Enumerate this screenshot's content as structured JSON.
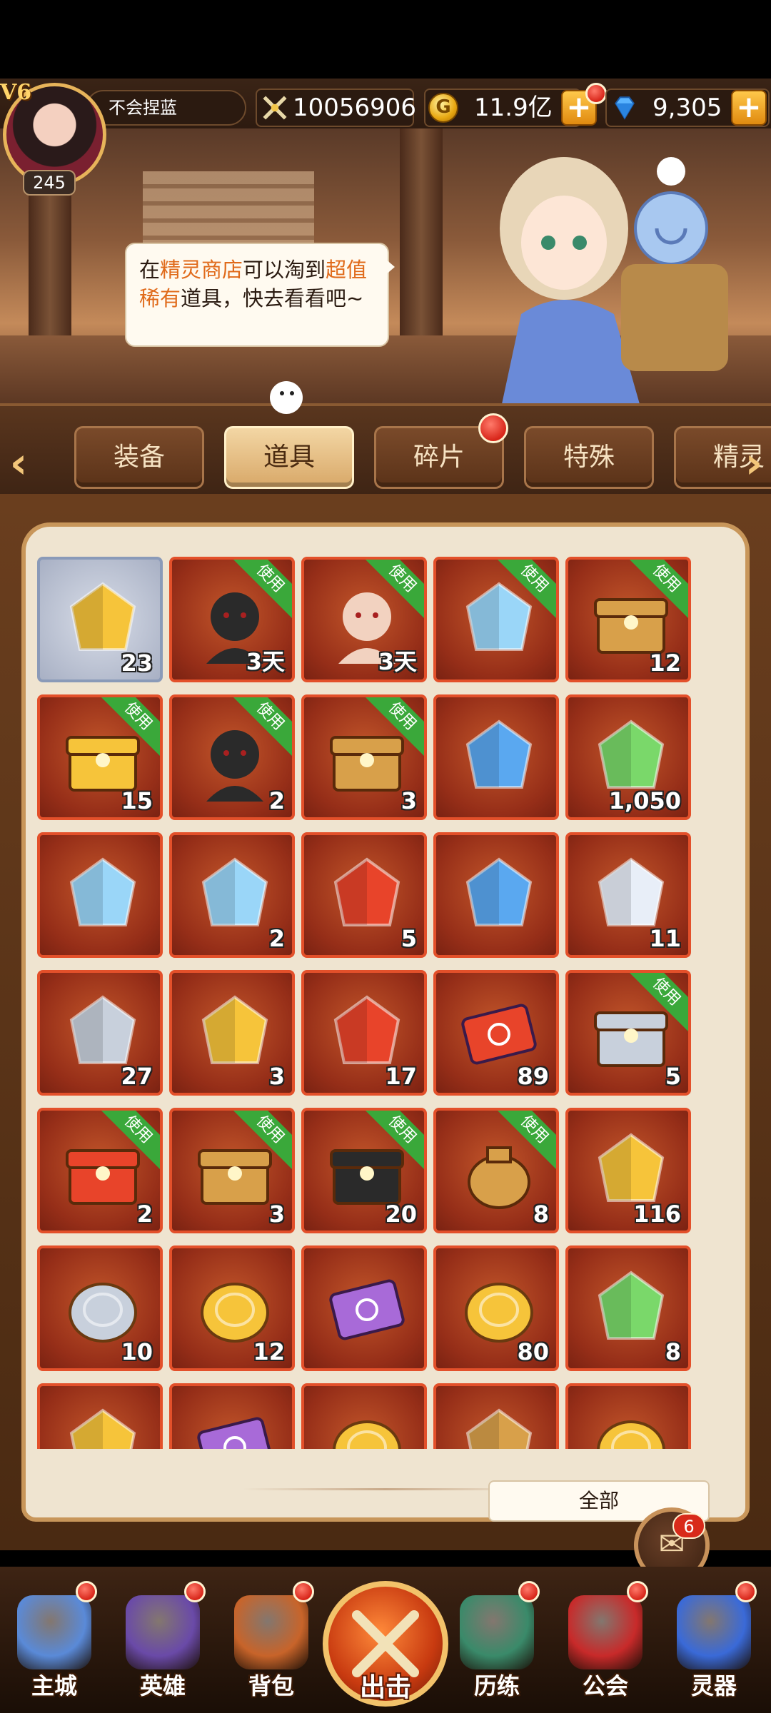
{
  "player": {
    "vip": "V6",
    "level": "245",
    "name": "不会捏蓝"
  },
  "currencies": {
    "power": "10056906",
    "gold": "11.9亿",
    "gold_icon": "G",
    "gems": "9,305",
    "plus": "+"
  },
  "npc_speech": {
    "part1": "在",
    "part2": "精灵商店",
    "part3": "可以淘到",
    "part4": "超值稀有",
    "part5": "道具，快去看看吧~"
  },
  "tabs": [
    {
      "label": "装备"
    },
    {
      "label": "道具"
    },
    {
      "label": "碎片"
    },
    {
      "label": "特殊"
    },
    {
      "label": "精灵"
    }
  ],
  "arrows": {
    "left": "‹",
    "right": "›"
  },
  "use_label": "使用",
  "items": [
    {
      "count": "23",
      "icon": "gold-crystal-icon",
      "use": false,
      "gray": true
    },
    {
      "count": "3天",
      "icon": "hero-portrait-dark-hair-icon",
      "use": true
    },
    {
      "count": "3天",
      "icon": "hero-portrait-blonde-icon",
      "use": true
    },
    {
      "count": "",
      "icon": "mystery-blue-crystal-icon",
      "use": true
    },
    {
      "count": "12",
      "icon": "treasure-chest-icon",
      "use": true
    },
    {
      "count": "15",
      "icon": "golden-chest-icon",
      "use": true
    },
    {
      "count": "2",
      "icon": "dark-knight-icon",
      "use": true
    },
    {
      "count": "3",
      "icon": "gem-chest-icon",
      "use": true
    },
    {
      "count": "",
      "icon": "blue-crystal-icon",
      "use": false
    },
    {
      "count": "1,050",
      "icon": "rainbow-crystal-icon",
      "use": false
    },
    {
      "count": "",
      "icon": "ice-crystal-icon",
      "use": false
    },
    {
      "count": "2",
      "icon": "swirl-crystal-icon",
      "use": false
    },
    {
      "count": "5",
      "icon": "fire-crystal-icon",
      "use": false
    },
    {
      "count": "",
      "icon": "rune-crystal-icon",
      "use": false
    },
    {
      "count": "11",
      "icon": "white-crystal-icon",
      "use": false
    },
    {
      "count": "27",
      "icon": "silver-ore-icon",
      "use": false
    },
    {
      "count": "3",
      "icon": "gold-diamond-icon",
      "use": false
    },
    {
      "count": "17",
      "icon": "red-flame-crystal-icon",
      "use": false
    },
    {
      "count": "89",
      "icon": "spellbook-icon",
      "use": false
    },
    {
      "count": "5",
      "icon": "silver-chest-icon",
      "use": true
    },
    {
      "count": "2",
      "icon": "gift-box-icon",
      "use": true
    },
    {
      "count": "3",
      "icon": "potion-crate-icon",
      "use": true
    },
    {
      "count": "20",
      "icon": "dark-chest-icon",
      "use": true
    },
    {
      "count": "8",
      "icon": "treasure-sack-icon",
      "use": true
    },
    {
      "count": "116",
      "icon": "sun-rune-icon",
      "use": false
    },
    {
      "count": "10",
      "icon": "silver-coin-icon",
      "use": false
    },
    {
      "count": "12",
      "icon": "gold-coin-icon",
      "use": false
    },
    {
      "count": "",
      "icon": "purple-ticket-icon",
      "use": false
    },
    {
      "count": "80",
      "icon": "gold-ingot-icon",
      "use": false
    },
    {
      "count": "8",
      "icon": "green-rune-icon",
      "use": false
    },
    {
      "count": "",
      "icon": "gold-emblem-icon",
      "use": false
    },
    {
      "count": "",
      "icon": "purple-ticket-icon",
      "use": false
    },
    {
      "count": "",
      "icon": "gold-ingot-icon",
      "use": false
    },
    {
      "count": "",
      "icon": "scroll-icon",
      "use": false
    },
    {
      "count": "",
      "icon": "gold-ingot-icon",
      "use": false
    }
  ],
  "filter": {
    "label": "全部"
  },
  "chat": {
    "badge": "6",
    "icon": "chat-icon"
  },
  "nav": [
    {
      "label": "主城",
      "icon": "castle-icon"
    },
    {
      "label": "英雄",
      "icon": "helmet-icon"
    },
    {
      "label": "背包",
      "icon": "backpack-icon"
    },
    {
      "label": "出击",
      "icon": "crossed-swords-icon"
    },
    {
      "label": "历练",
      "icon": "training-icon"
    },
    {
      "label": "公会",
      "icon": "guild-icon"
    },
    {
      "label": "灵器",
      "icon": "orb-icon"
    }
  ]
}
